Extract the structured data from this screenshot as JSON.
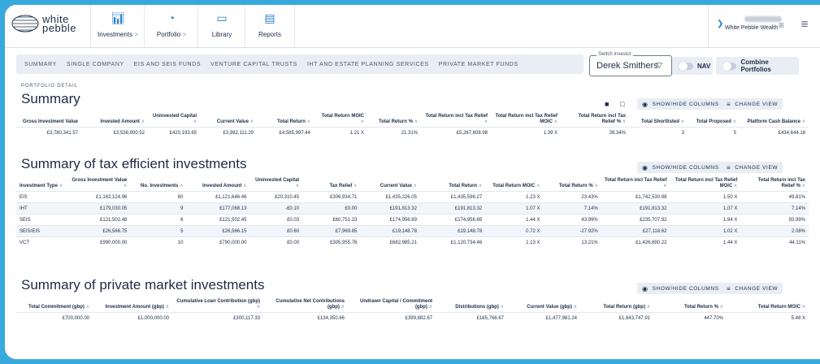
{
  "nav": {
    "logo_line1": "white",
    "logo_line2": "pebble",
    "items": [
      {
        "label": "Investments",
        "chev": " >"
      },
      {
        "label": "Portfolio",
        "chev": " >"
      },
      {
        "label": "Library",
        "chev": ""
      },
      {
        "label": "Reports",
        "chev": ""
      }
    ],
    "org": "White Pebble Wealth"
  },
  "tabs": [
    "SUMMARY",
    "SINGLE COMPANY",
    "EIS AND SEIS FUNDS",
    "VENTURE CAPITAL TRUSTS",
    "IHT AND ESTATE PLANNING SERVICES",
    "PRIVATE MARKET FUNDS"
  ],
  "investor": {
    "legend": "Switch Investor",
    "value": "Derek Smithers"
  },
  "toggles": {
    "nav": "NAV",
    "combine": "Combine Portfolios"
  },
  "portfolio_detail": "PORTFOLIO DETAIL",
  "buttons": {
    "show_hide": "SHOW/HIDE COLUMNS",
    "change_view": "CHANGE VIEW"
  },
  "summary": {
    "title": "Summary",
    "headers": [
      "Gross Investment Value",
      "Invested Amount",
      "Uninvested Capital",
      "Current Value",
      "Total Return",
      "Total Return MOIC",
      "Total Return %",
      "Total Return incl Tax Relief",
      "Total Return incl Tax Relief MOIC",
      "Total Return incl Tax Relief %",
      "Total Shortlisted",
      "Total Proposed",
      "Platform Cash Balance"
    ],
    "row": [
      "£3,780,341.57",
      "£3,536,900.52",
      "£420,193.65",
      "£3,982,111.29",
      "£4,585,997.44",
      "1.21 X",
      "21.31%",
      "£5,267,608.98",
      "1.39 X",
      "39.34%",
      "3",
      "5",
      "£434,644.18"
    ]
  },
  "tax": {
    "title": "Summary of tax efficient investments",
    "headers": [
      "Investment Type",
      "Gross Investment Value",
      "No. Investments",
      "Invested Amount",
      "Uninvested Capital",
      "Tax Relief",
      "Current Value",
      "Total Return",
      "Total Return MOIC",
      "Total Return %",
      "Total Return incl Tax Relief",
      "Total Return incl Tax Relief MOIC",
      "Total Return incl Tax Relief %"
    ],
    "rows": [
      [
        "EIS",
        "£1,163,124.96",
        "60",
        "£1,121,646.46",
        "£20,310.45",
        "£306,934.71",
        "£1,435,226.05",
        "£1,435,596.27",
        "1.23 X",
        "23.43%",
        "£1,742,530.98",
        "1.50 X",
        "49.81%"
      ],
      [
        "IHT",
        "£179,030.05",
        "9",
        "£177,068.13",
        "-£0.10",
        "£0.00",
        "£191,813.32",
        "£191,813.32",
        "1.07 X",
        "7.14%",
        "£191,813.32",
        "1.07 X",
        "7.14%"
      ],
      [
        "SEIS",
        "£121,502.48",
        "6",
        "£121,502.45",
        "£0.03",
        "£60,751.23",
        "£174,956.69",
        "£174,956.69",
        "1.44 X",
        "43.99%",
        "£235,707.92",
        "1.94 X",
        "93.99%"
      ],
      [
        "SEIS/EIS",
        "£26,566.75",
        "5",
        "£26,566.15",
        "£0.60",
        "£7,969.85",
        "£19,148.78",
        "£19,148.78",
        "0.72 X",
        "-27.92%",
        "£27,118.62",
        "1.02 X",
        "2.08%"
      ],
      [
        "VCT",
        "£990,000.00",
        "10",
        "£790,000.00",
        "£0.00",
        "£305,955.76",
        "£682,985.21",
        "£1,120,734.46",
        "1.13 X",
        "13.21%",
        "£1,426,690.22",
        "1.44 X",
        "44.11%"
      ]
    ]
  },
  "pm": {
    "title": "Summary of private market investments",
    "headers": [
      "Total Commitment (gbp)",
      "Investment Amount (gbp)",
      "Cumulative Loan Contribution (gbp)",
      "Cumulative Net Contributions (gbp)",
      "Undrawn Capital / Commitment (gbp)",
      "Distributions (gbp)",
      "Current Value (gbp)",
      "Total Return (gbp)",
      "Total Return %",
      "Total Return MOIC"
    ],
    "row": [
      "£700,000.00",
      "£1,000,000.00",
      "£300,117.33",
      "£134,350.66",
      "£399,882.67",
      "£165,766.67",
      "£1,477,981.24",
      "£1,643,747.91",
      "447.70%",
      "5.48 X"
    ]
  }
}
